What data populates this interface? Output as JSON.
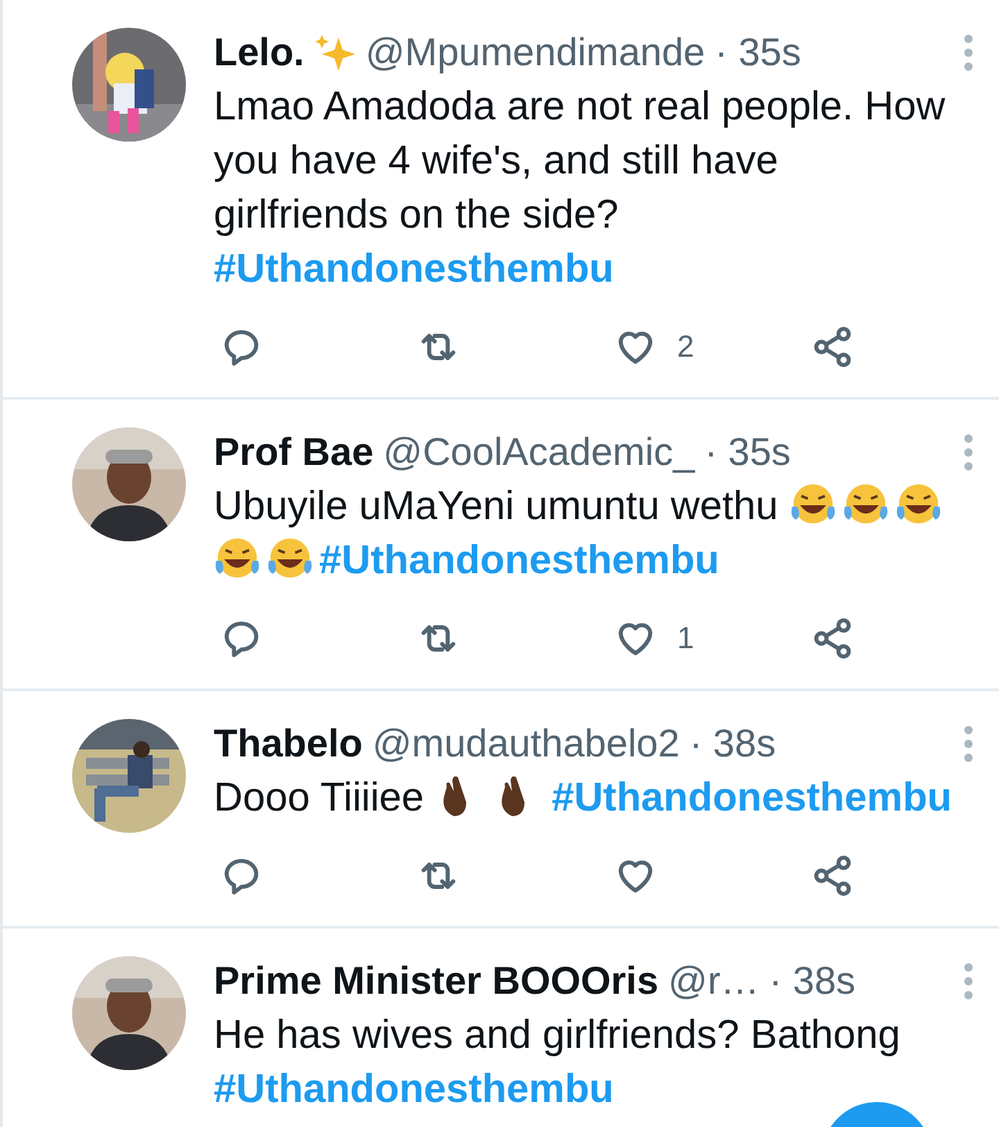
{
  "tweets": [
    {
      "name": "Lelo.",
      "name_icons": [
        {
          "kind": "sparkle"
        }
      ],
      "handle": "@Mpumendimande",
      "time": "· 35s",
      "avatar": {
        "kind": "picture"
      },
      "body": [
        {
          "kind": "text",
          "text": "Lmao Amadoda are not real people. How you have 4 wife's, and still have girlfriends on the side?"
        },
        {
          "kind": "break"
        },
        {
          "kind": "hashtag",
          "text": "#Uthandonesthembu"
        }
      ],
      "actions": {
        "kind": "bar",
        "likes": "2"
      }
    },
    {
      "name": "Prof Bae",
      "handle": "@CoolAcademic_",
      "time": "· 35s",
      "avatar": {
        "kind": "picture"
      },
      "body": [
        {
          "kind": "text",
          "text": "Ubuyile uMaYeni umuntu wethu "
        },
        {
          "kind": "laugh"
        },
        {
          "kind": "laugh"
        },
        {
          "kind": "laugh"
        },
        {
          "kind": "laugh"
        },
        {
          "kind": "laugh"
        },
        {
          "kind": "hashtag",
          "text": "#Uthandonesthembu"
        }
      ],
      "actions": {
        "kind": "bar",
        "likes": "1"
      }
    },
    {
      "name": "Thabelo",
      "handle": "@mudauthabelo2",
      "time": "· 38s",
      "avatar": {
        "kind": "picture"
      },
      "body": [
        {
          "kind": "text",
          "text": "Dooo Tiiiiee "
        },
        {
          "kind": "fingers"
        },
        {
          "kind": "fingers"
        },
        {
          "kind": "hashtag",
          "text": "#Uthandonesthembu"
        }
      ],
      "actions": {
        "kind": "bar"
      }
    },
    {
      "name": "Prime Minister BOOOris",
      "handle": "@r…",
      "time": "· 38s",
      "avatar": {
        "kind": "picture"
      },
      "body": [
        {
          "kind": "text",
          "text": "He has wives and girlfriends? Bathong"
        },
        {
          "kind": "break"
        },
        {
          "kind": "hashtag",
          "text": "#Uthandonesthembu"
        }
      ]
    }
  ]
}
